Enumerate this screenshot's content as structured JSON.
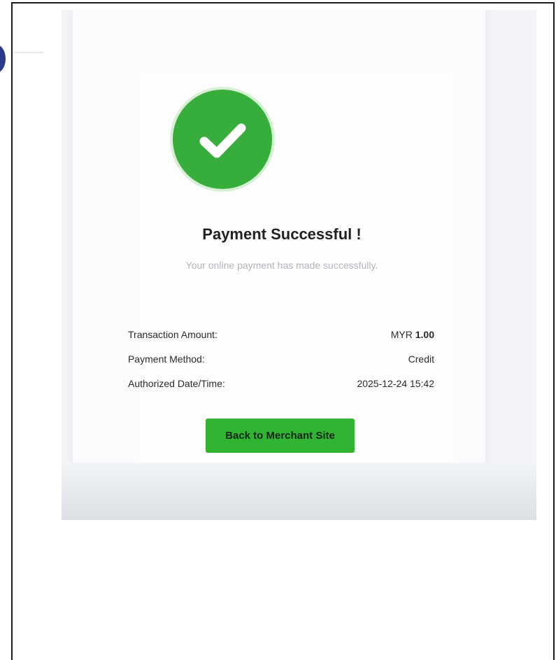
{
  "status": {
    "title": "Payment Successful !",
    "message": "Your online payment has made successfully."
  },
  "details": {
    "amount_label": "Transaction Amount:",
    "amount_currency": "MYR",
    "amount_value": "1.00",
    "method_label": "Payment Method:",
    "method_value": "Credit",
    "datetime_label": "Authorized Date/Time:",
    "datetime_value": "2025-12-24 15:42"
  },
  "actions": {
    "back_label": "Back to Merchant Site"
  },
  "colors": {
    "success_green": "#37ad3c",
    "button_green": "#30b431"
  }
}
